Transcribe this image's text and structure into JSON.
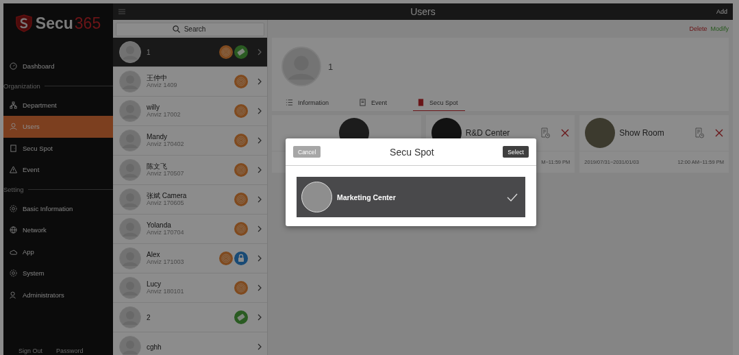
{
  "brand": {
    "name": "Secu",
    "suffix": "365"
  },
  "sidebar": {
    "items": [
      {
        "kind": "item",
        "label": "Dashboard",
        "selected": false
      },
      {
        "kind": "section",
        "label": "Organization"
      },
      {
        "kind": "item",
        "label": "Department",
        "selected": false
      },
      {
        "kind": "item",
        "label": "Users",
        "selected": true
      },
      {
        "kind": "item",
        "label": "Secu Spot",
        "selected": false
      },
      {
        "kind": "item",
        "label": "Event",
        "selected": false
      },
      {
        "kind": "section",
        "label": "Setting"
      },
      {
        "kind": "item",
        "label": "Basic Information",
        "selected": false
      },
      {
        "kind": "item",
        "label": "Network",
        "selected": false
      },
      {
        "kind": "item",
        "label": "App",
        "selected": false
      },
      {
        "kind": "item",
        "label": "System",
        "selected": false
      },
      {
        "kind": "item",
        "label": "Administrators",
        "selected": false
      }
    ],
    "footer": [
      "Sign Out",
      "Password"
    ]
  },
  "header": {
    "title": "Users",
    "add": "Add"
  },
  "search": {
    "placeholder": "Search"
  },
  "users": [
    {
      "name": "1",
      "selected": true,
      "badges": [
        {
          "kind": "fingerprint"
        },
        {
          "kind": "card"
        }
      ]
    },
    {
      "name": "王仲中",
      "id": "Anviz 1409",
      "selected": false,
      "badges": [
        {
          "kind": "fingerprint"
        }
      ]
    },
    {
      "name": "willy",
      "id": "Anviz 17002",
      "selected": false,
      "badges": [
        {
          "kind": "fingerprint"
        }
      ]
    },
    {
      "name": "Mandy",
      "id": "Anviz 170402",
      "selected": false,
      "badges": [
        {
          "kind": "fingerprint"
        }
      ]
    },
    {
      "name": "陈文飞",
      "id": "Anviz 170507",
      "selected": false,
      "badges": [
        {
          "kind": "fingerprint"
        }
      ]
    },
    {
      "name": "张斌 Camera",
      "id": "Anviz 170605",
      "selected": false,
      "badges": [
        {
          "kind": "fingerprint"
        }
      ]
    },
    {
      "name": "Yolanda",
      "id": "Anviz 170704",
      "selected": false,
      "badges": [
        {
          "kind": "fingerprint"
        }
      ]
    },
    {
      "name": "Alex",
      "id": "Anviz 171003",
      "selected": false,
      "badges": [
        {
          "kind": "fingerprint"
        },
        {
          "kind": "lock"
        }
      ]
    },
    {
      "name": "Lucy",
      "id": "Anviz 180101",
      "selected": false,
      "badges": [
        {
          "kind": "fingerprint"
        }
      ]
    },
    {
      "name": "2",
      "selected": false,
      "badges": [
        {
          "kind": "card"
        }
      ]
    },
    {
      "name": "cghh",
      "selected": false
    }
  ],
  "actions": {
    "delete": "Delete",
    "modify": "Modify"
  },
  "profile": {
    "name": "1"
  },
  "tabs": [
    {
      "label": "Information",
      "selected": false
    },
    {
      "label": "Event",
      "selected": false
    },
    {
      "label": "Secu Spot",
      "selected": true
    }
  ],
  "spots": [
    {
      "kind": "covered"
    },
    {
      "kind": "spot",
      "name": "R&D Center",
      "time": "M~11:59 PM"
    },
    {
      "kind": "spot",
      "name": "Show Room",
      "date": "2019/07/31~2031/01/03",
      "time": "12:00 AM~11:59 PM"
    }
  ],
  "dialog": {
    "title": "Secu Spot",
    "cancel": "Cancel",
    "select": "Select",
    "items": [
      {
        "name": "Marketing Center",
        "checked": true
      }
    ]
  }
}
